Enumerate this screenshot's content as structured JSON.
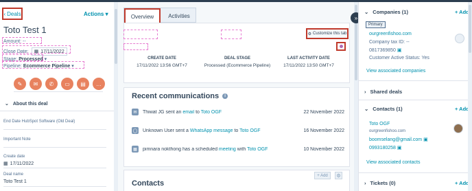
{
  "left": {
    "back_label": "Deals",
    "actions_label": "Actions",
    "record_title": "Toto Test 1",
    "amount": "Amount: --",
    "close_date_label": "Close Date:",
    "close_date_value": "17/11/2022",
    "stage_label": "Stage:",
    "stage_value": "Processed",
    "pipeline_label": "Pipeline:",
    "pipeline_value": "Ecommerce Pipeline",
    "action_icons": [
      "note-icon",
      "email-icon",
      "call-icon",
      "task-icon",
      "meeting-icon",
      "more-icon"
    ],
    "about_title": "About this deal",
    "fields": [
      {
        "label": "End Date HubSpot Software (Old Deal)",
        "value": ""
      },
      {
        "label": "Important Note",
        "value": ""
      },
      {
        "label": "Create date",
        "value": "17/11/2022"
      },
      {
        "label": "Deal name",
        "value": "Toto Test 1"
      }
    ]
  },
  "middle": {
    "tabs": [
      {
        "label": "Overview"
      },
      {
        "label": "Activities"
      }
    ],
    "customize_label": "Customize this tab",
    "columns": [
      {
        "head": "CREATE DATE",
        "value": "17/11/2022 13:56 GMT+7"
      },
      {
        "head": "DEAL STAGE",
        "value": "Processed (Ecommerce Pipeline)"
      },
      {
        "head": "LAST ACTIVITY DATE",
        "value": "17/11/2022 13:50 GMT+7"
      }
    ],
    "recent_title": "Recent communications",
    "communications": [
      {
        "pre": "Thiwat JG sent an",
        "link1": "email",
        "mid": "to",
        "link2": "Toto OGF",
        "date": "22 November 2022"
      },
      {
        "pre": "Unknown User sent a",
        "link1": "WhatsApp message",
        "mid": "to",
        "link2": "Toto OGF",
        "date": "16 November 2022"
      },
      {
        "pre": "pimnara nokthong has a scheduled",
        "link1": "meeting",
        "mid": "with",
        "link2": "Toto OGF",
        "date": "10 November 2022"
      }
    ],
    "add_label": "+ Add",
    "contacts_title": "Contacts"
  },
  "right": {
    "companies_title": "Companies (1)",
    "add_label": "+ Add",
    "primary_tag": "Primary",
    "company_domain": "ourgreenfishoo.com",
    "tax_id": "Company tax ID: --",
    "phone": "0817369850",
    "active_status": "Customer Active Status: Yes",
    "view_companies": "View associated companies",
    "shared_deals": "Shared deals",
    "contacts_title": "Contacts (1)",
    "contact_name": "Toto OGF",
    "contact_domain": "ourgreenfishoo.com",
    "contact_email": "boomselang@gmail.com",
    "contact_phone": "0993180258",
    "view_contacts": "View associated contacts",
    "tickets_title": "Tickets (0)"
  },
  "colors": {
    "accent": "#0091ae",
    "highlight": "#c0392b",
    "action": "#e8825f"
  }
}
